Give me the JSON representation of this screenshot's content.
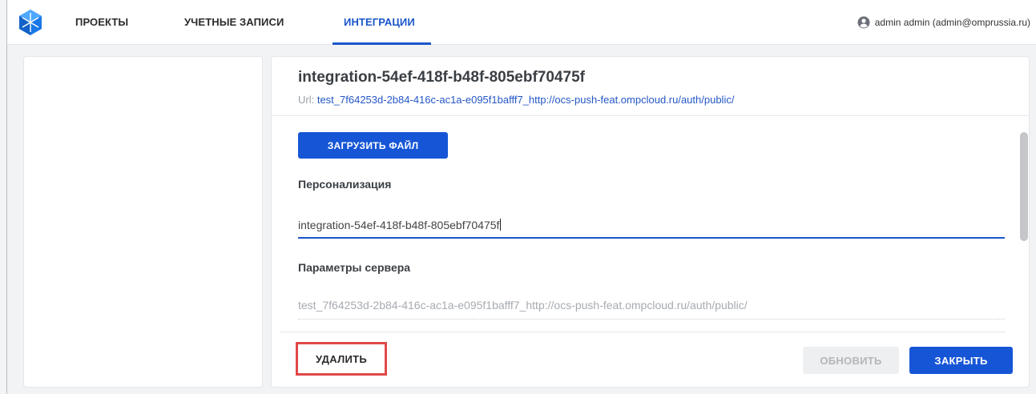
{
  "nav": {
    "items": [
      {
        "label": "ПРОЕКТЫ"
      },
      {
        "label": "УЧЕТНЫЕ ЗАПИСИ"
      },
      {
        "label": "ИНТЕГРАЦИИ"
      }
    ],
    "active_index": 2
  },
  "user": {
    "label": "admin admin (admin@omprussia.ru)",
    "icon": "user-circle-icon"
  },
  "integration": {
    "title": "integration-54ef-418f-b48f-805ebf70475f",
    "url_label": "Url:",
    "url_value": "test_7f64253d-2b84-416c-ac1a-e095f1bafff7_http://ocs-push-feat.ompcloud.ru/auth/public/"
  },
  "form": {
    "upload_label": "ЗАГРУЗИТЬ ФАЙЛ",
    "personalization_label": "Персонализация",
    "personalization_value": "integration-54ef-418f-b48f-805ebf70475f",
    "server_params_label": "Параметры сервера",
    "server_params_value": "test_7f64253d-2b84-416c-ac1a-e095f1bafff7_http://ocs-push-feat.ompcloud.ru/auth/public/"
  },
  "footer": {
    "delete_label": "УДАЛИТЬ",
    "update_label": "ОБНОВИТЬ",
    "close_label": "ЗАКРЫТЬ"
  },
  "colors": {
    "accent": "#1656d6",
    "highlight": "#e04848",
    "disabled": "#eeeff1"
  }
}
